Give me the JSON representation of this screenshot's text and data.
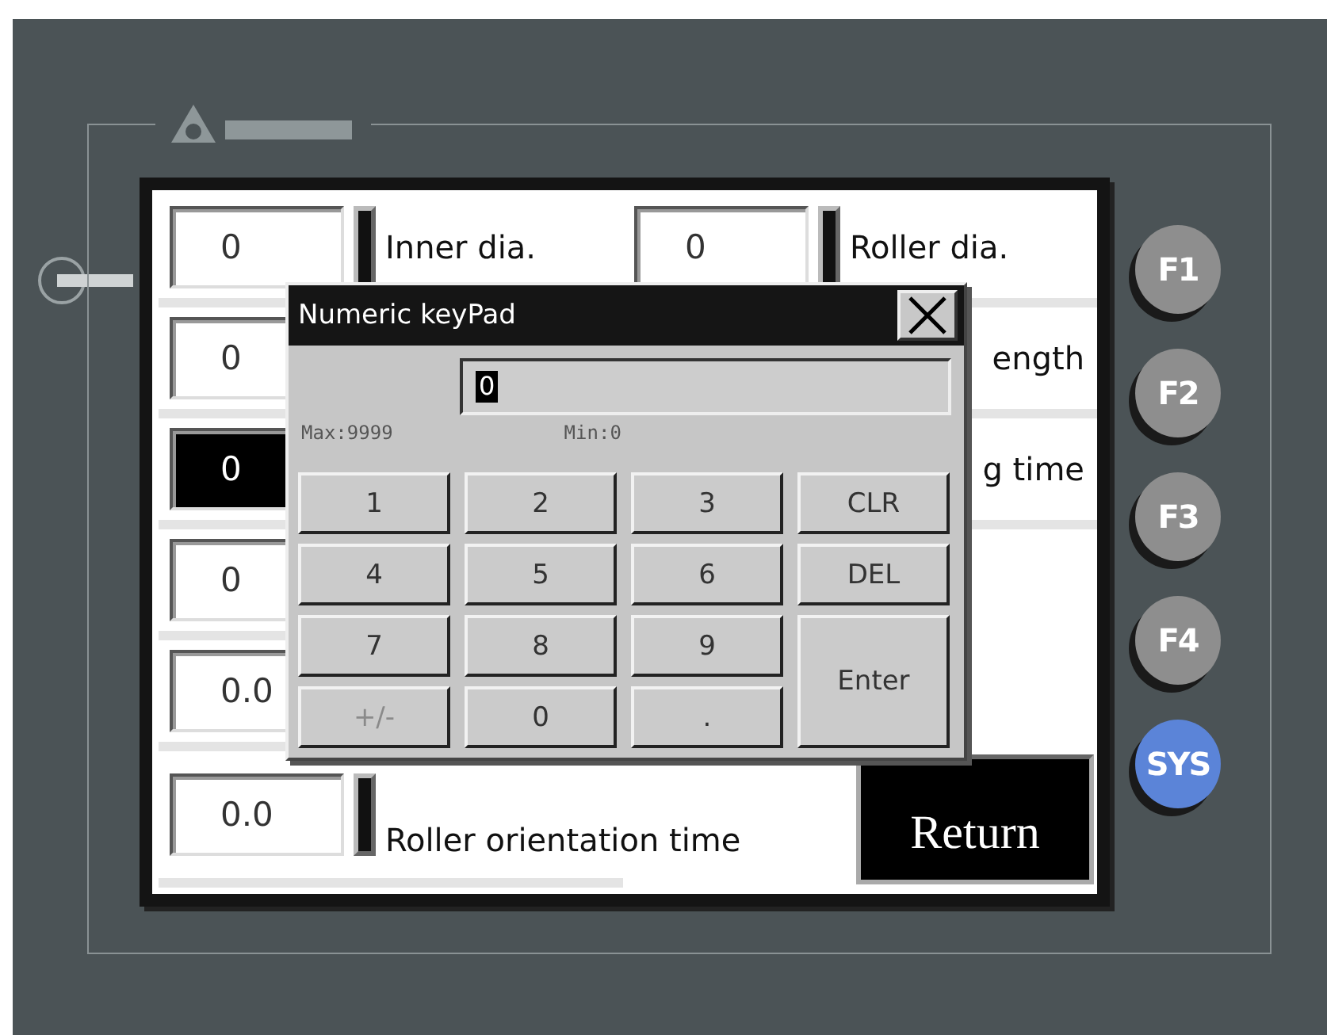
{
  "screen": {
    "left_rows": [
      {
        "value": "0",
        "selected": false,
        "label": "Inner dia."
      },
      {
        "value": "0",
        "selected": false
      },
      {
        "value": "0",
        "selected": true
      },
      {
        "value": "0",
        "selected": false
      },
      {
        "value": "0.0",
        "selected": false
      },
      {
        "value": "0.0",
        "selected": false,
        "label": "Roller orientation time"
      }
    ],
    "right_rows": [
      {
        "value": "0",
        "selected": false,
        "label": "Roller dia."
      },
      {
        "label": "ength"
      },
      {
        "label": "g time"
      }
    ],
    "return_button": "Return"
  },
  "keypad": {
    "title": "Numeric keyPad",
    "display": {
      "value": "0",
      "selected": true
    },
    "max": "Max:9999",
    "min": "Min:0",
    "keys": [
      {
        "label": "1",
        "kind": "normal",
        "disabled": false
      },
      {
        "label": "2",
        "kind": "normal",
        "disabled": false
      },
      {
        "label": "3",
        "kind": "normal",
        "disabled": false
      },
      {
        "label": "CLR",
        "kind": "normal",
        "disabled": false
      },
      {
        "label": "4",
        "kind": "normal",
        "disabled": false
      },
      {
        "label": "5",
        "kind": "normal",
        "disabled": false
      },
      {
        "label": "6",
        "kind": "normal",
        "disabled": false
      },
      {
        "label": "DEL",
        "kind": "normal",
        "disabled": false
      },
      {
        "label": "7",
        "kind": "normal",
        "disabled": false
      },
      {
        "label": "8",
        "kind": "normal",
        "disabled": false
      },
      {
        "label": "9",
        "kind": "normal",
        "disabled": false
      },
      {
        "label": "Enter",
        "kind": "tall",
        "disabled": false
      },
      {
        "label": "+/-",
        "kind": "normal",
        "disabled": true
      },
      {
        "label": "0",
        "kind": "normal",
        "disabled": false
      },
      {
        "label": ".",
        "kind": "normal",
        "disabled": false
      }
    ]
  },
  "function_keys": [
    {
      "label": "F1",
      "color": "#8e8e8e"
    },
    {
      "label": "F2",
      "color": "#8e8e8e"
    },
    {
      "label": "F3",
      "color": "#8e8e8e"
    },
    {
      "label": "F4",
      "color": "#8e8e8e"
    },
    {
      "label": "SYS",
      "color": "#5b84d8"
    }
  ]
}
